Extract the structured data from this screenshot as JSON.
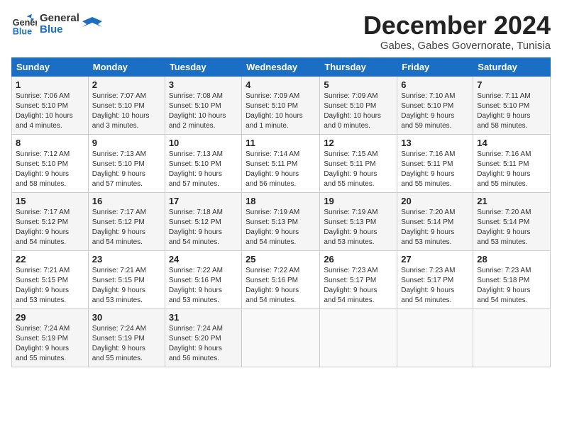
{
  "logo": {
    "line1": "General",
    "line2": "Blue"
  },
  "title": "December 2024",
  "subtitle": "Gabes, Gabes Governorate, Tunisia",
  "days_of_week": [
    "Sunday",
    "Monday",
    "Tuesday",
    "Wednesday",
    "Thursday",
    "Friday",
    "Saturday"
  ],
  "weeks": [
    [
      {
        "day": 1,
        "info": "Sunrise: 7:06 AM\nSunset: 5:10 PM\nDaylight: 10 hours\nand 4 minutes."
      },
      {
        "day": 2,
        "info": "Sunrise: 7:07 AM\nSunset: 5:10 PM\nDaylight: 10 hours\nand 3 minutes."
      },
      {
        "day": 3,
        "info": "Sunrise: 7:08 AM\nSunset: 5:10 PM\nDaylight: 10 hours\nand 2 minutes."
      },
      {
        "day": 4,
        "info": "Sunrise: 7:09 AM\nSunset: 5:10 PM\nDaylight: 10 hours\nand 1 minute."
      },
      {
        "day": 5,
        "info": "Sunrise: 7:09 AM\nSunset: 5:10 PM\nDaylight: 10 hours\nand 0 minutes."
      },
      {
        "day": 6,
        "info": "Sunrise: 7:10 AM\nSunset: 5:10 PM\nDaylight: 9 hours\nand 59 minutes."
      },
      {
        "day": 7,
        "info": "Sunrise: 7:11 AM\nSunset: 5:10 PM\nDaylight: 9 hours\nand 58 minutes."
      }
    ],
    [
      {
        "day": 8,
        "info": "Sunrise: 7:12 AM\nSunset: 5:10 PM\nDaylight: 9 hours\nand 58 minutes."
      },
      {
        "day": 9,
        "info": "Sunrise: 7:13 AM\nSunset: 5:10 PM\nDaylight: 9 hours\nand 57 minutes."
      },
      {
        "day": 10,
        "info": "Sunrise: 7:13 AM\nSunset: 5:10 PM\nDaylight: 9 hours\nand 57 minutes."
      },
      {
        "day": 11,
        "info": "Sunrise: 7:14 AM\nSunset: 5:11 PM\nDaylight: 9 hours\nand 56 minutes."
      },
      {
        "day": 12,
        "info": "Sunrise: 7:15 AM\nSunset: 5:11 PM\nDaylight: 9 hours\nand 55 minutes."
      },
      {
        "day": 13,
        "info": "Sunrise: 7:16 AM\nSunset: 5:11 PM\nDaylight: 9 hours\nand 55 minutes."
      },
      {
        "day": 14,
        "info": "Sunrise: 7:16 AM\nSunset: 5:11 PM\nDaylight: 9 hours\nand 55 minutes."
      }
    ],
    [
      {
        "day": 15,
        "info": "Sunrise: 7:17 AM\nSunset: 5:12 PM\nDaylight: 9 hours\nand 54 minutes."
      },
      {
        "day": 16,
        "info": "Sunrise: 7:17 AM\nSunset: 5:12 PM\nDaylight: 9 hours\nand 54 minutes."
      },
      {
        "day": 17,
        "info": "Sunrise: 7:18 AM\nSunset: 5:12 PM\nDaylight: 9 hours\nand 54 minutes."
      },
      {
        "day": 18,
        "info": "Sunrise: 7:19 AM\nSunset: 5:13 PM\nDaylight: 9 hours\nand 54 minutes."
      },
      {
        "day": 19,
        "info": "Sunrise: 7:19 AM\nSunset: 5:13 PM\nDaylight: 9 hours\nand 53 minutes."
      },
      {
        "day": 20,
        "info": "Sunrise: 7:20 AM\nSunset: 5:14 PM\nDaylight: 9 hours\nand 53 minutes."
      },
      {
        "day": 21,
        "info": "Sunrise: 7:20 AM\nSunset: 5:14 PM\nDaylight: 9 hours\nand 53 minutes."
      }
    ],
    [
      {
        "day": 22,
        "info": "Sunrise: 7:21 AM\nSunset: 5:15 PM\nDaylight: 9 hours\nand 53 minutes."
      },
      {
        "day": 23,
        "info": "Sunrise: 7:21 AM\nSunset: 5:15 PM\nDaylight: 9 hours\nand 53 minutes."
      },
      {
        "day": 24,
        "info": "Sunrise: 7:22 AM\nSunset: 5:16 PM\nDaylight: 9 hours\nand 53 minutes."
      },
      {
        "day": 25,
        "info": "Sunrise: 7:22 AM\nSunset: 5:16 PM\nDaylight: 9 hours\nand 54 minutes."
      },
      {
        "day": 26,
        "info": "Sunrise: 7:23 AM\nSunset: 5:17 PM\nDaylight: 9 hours\nand 54 minutes."
      },
      {
        "day": 27,
        "info": "Sunrise: 7:23 AM\nSunset: 5:17 PM\nDaylight: 9 hours\nand 54 minutes."
      },
      {
        "day": 28,
        "info": "Sunrise: 7:23 AM\nSunset: 5:18 PM\nDaylight: 9 hours\nand 54 minutes."
      }
    ],
    [
      {
        "day": 29,
        "info": "Sunrise: 7:24 AM\nSunset: 5:19 PM\nDaylight: 9 hours\nand 55 minutes."
      },
      {
        "day": 30,
        "info": "Sunrise: 7:24 AM\nSunset: 5:19 PM\nDaylight: 9 hours\nand 55 minutes."
      },
      {
        "day": 31,
        "info": "Sunrise: 7:24 AM\nSunset: 5:20 PM\nDaylight: 9 hours\nand 56 minutes."
      },
      null,
      null,
      null,
      null
    ]
  ]
}
